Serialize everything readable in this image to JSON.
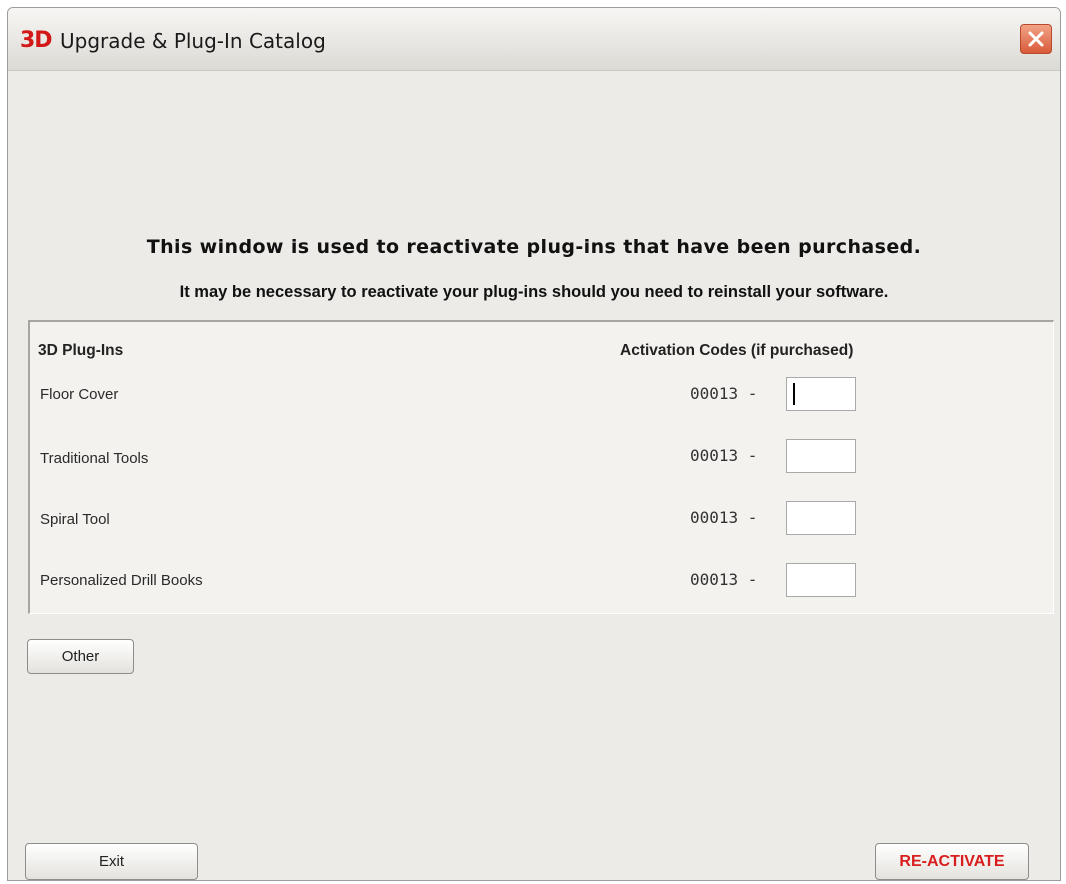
{
  "window": {
    "logo": "3D",
    "title": "Upgrade & Plug-In Catalog"
  },
  "heading": "This window is used to reactivate plug-ins that have been purchased.",
  "subheading": "It may be necessary to reactivate your plug-ins should you need to reinstall your software.",
  "table": {
    "col_plugins": "3D Plug-Ins",
    "col_codes": "Activation Codes (if purchased)",
    "rows": [
      {
        "label": "Floor Cover",
        "prefix": "00013  -",
        "value": ""
      },
      {
        "label": "Traditional Tools",
        "prefix": "00013  -",
        "value": ""
      },
      {
        "label": "Spiral Tool",
        "prefix": "00013  -",
        "value": ""
      },
      {
        "label": "Personalized Drill Books",
        "prefix": "00013  -",
        "value": ""
      }
    ]
  },
  "buttons": {
    "other": "Other",
    "exit": "Exit",
    "reactivate": "RE-ACTIVATE"
  },
  "colors": {
    "accent_red": "#d81e1e",
    "window_bg": "#ecebe8"
  }
}
